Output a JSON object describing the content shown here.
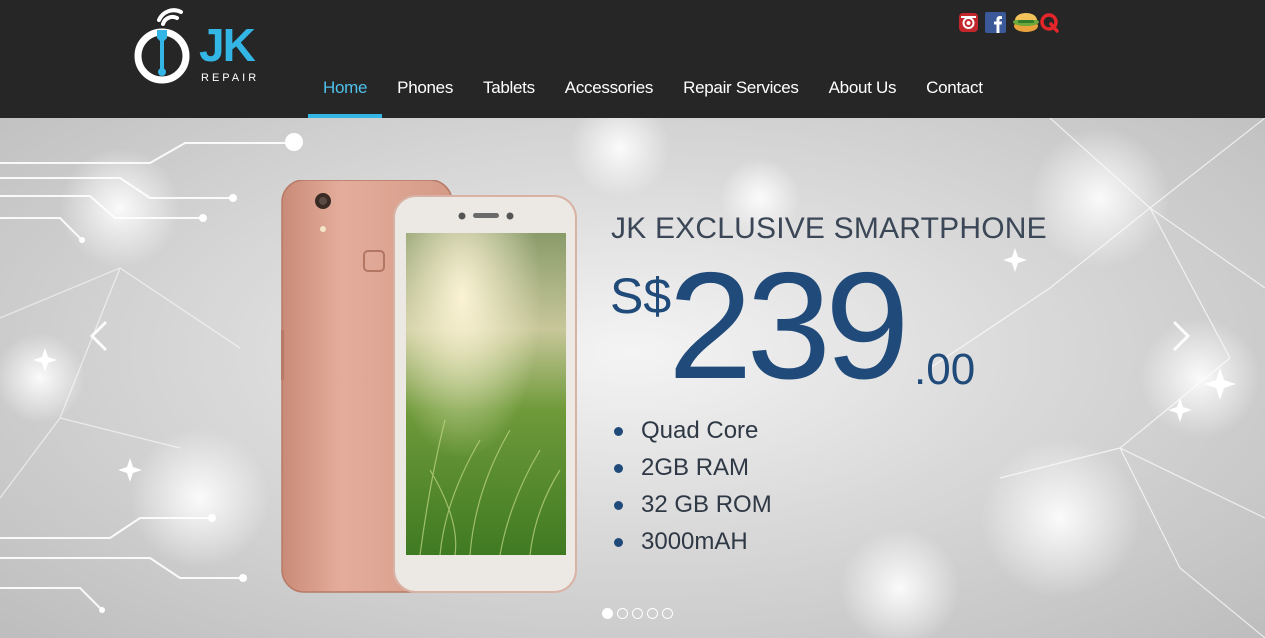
{
  "brand": {
    "name": "JK",
    "subtitle": "REPAIR",
    "accent_color": "#33b5e5",
    "header_bg": "#262626"
  },
  "social": [
    {
      "name": "instagram-icon",
      "color": "#c3272b"
    },
    {
      "name": "facebook-icon",
      "color": "#3b5998"
    },
    {
      "name": "burpple-icon",
      "color": "#6ea83a"
    },
    {
      "name": "qoo10-icon",
      "color": "#e4262a"
    }
  ],
  "nav": {
    "items": [
      {
        "label": "Home",
        "active": true
      },
      {
        "label": "Phones",
        "active": false
      },
      {
        "label": "Tablets",
        "active": false
      },
      {
        "label": "Accessories",
        "active": false
      },
      {
        "label": "Repair Services",
        "active": false
      },
      {
        "label": "About Us",
        "active": false
      },
      {
        "label": "Contact",
        "active": false
      }
    ]
  },
  "slider": {
    "title": "JK EXCLUSIVE SMARTPHONE",
    "currency": "S$",
    "price": "239",
    "cents": ".00",
    "price_color": "#1f4a7a",
    "specs": [
      "Quad Core",
      "2GB RAM",
      "32 GB ROM",
      "3000mAH"
    ],
    "slide_count": 5,
    "active_slide": 1,
    "prev_icon": "chevron-left-icon",
    "next_icon": "chevron-right-icon"
  }
}
